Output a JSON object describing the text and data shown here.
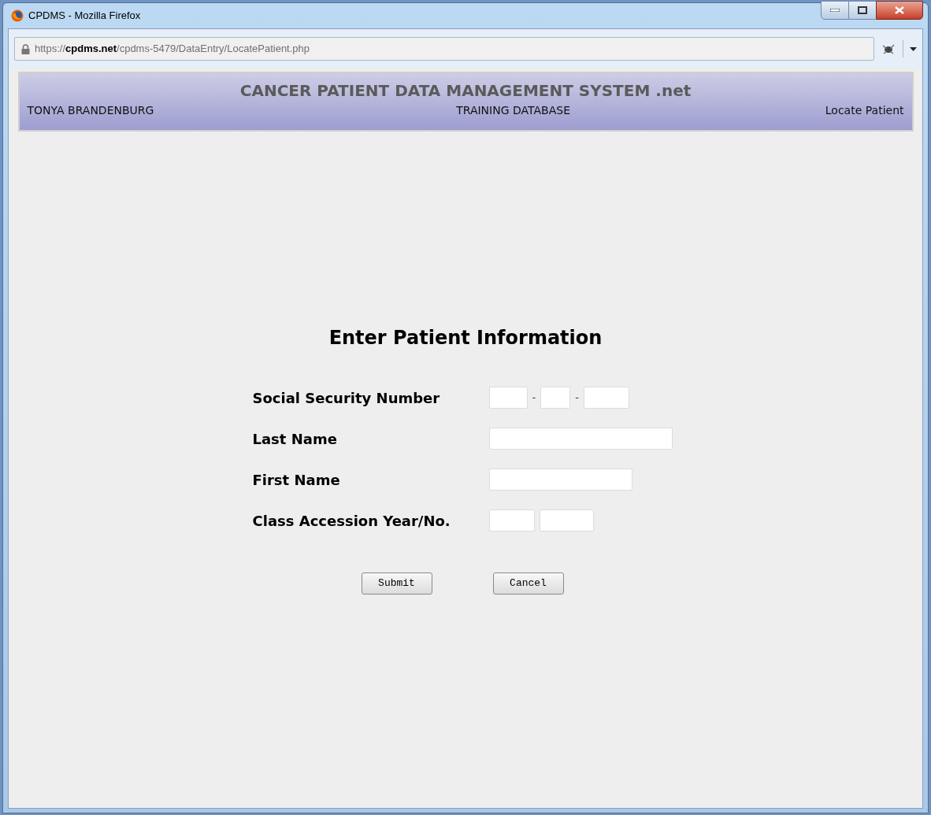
{
  "window": {
    "title": "CPDMS - Mozilla Firefox"
  },
  "address_bar": {
    "url": "https://**cpdms.net**/cpdms-5479/DataEntry/LocatePatient.php"
  },
  "header": {
    "title": "CANCER PATIENT DATA MANAGEMENT SYSTEM .net",
    "user": "TONYA BRANDENBURG",
    "database": "TRAINING DATABASE",
    "page": "Locate Patient"
  },
  "form": {
    "heading": "Enter Patient Information",
    "rows": [
      {
        "label": "Social Security Number",
        "kind": "ssn",
        "separators": [
          "-",
          "-"
        ]
      },
      {
        "label": "Last Name",
        "kind": "wide"
      },
      {
        "label": "First Name",
        "kind": "medium"
      },
      {
        "label": "Class Accession Year/No.",
        "kind": "pair"
      }
    ],
    "buttons": [
      "Submit",
      "Cancel"
    ]
  }
}
